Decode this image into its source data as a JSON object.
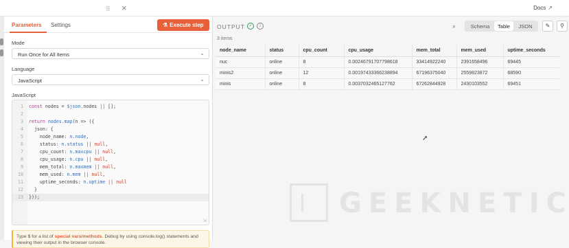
{
  "topbar": {
    "docs_label": "Docs",
    "docs_icon": "external-link-icon"
  },
  "params": {
    "tabs": [
      {
        "label": "Parameters"
      },
      {
        "label": "Settings"
      }
    ],
    "execute_label": "Execute step",
    "mode": {
      "label": "Mode",
      "value": "Run Once for All Items"
    },
    "language": {
      "label": "Language",
      "value": "JavaScript"
    },
    "code_label": "JavaScript",
    "code_lines": [
      "const nodes = $json.nodes || [];",
      "",
      "return nodes.map(n => ({",
      "  json: {",
      "    node_name: n.node,",
      "    status: n.status || null,",
      "    cpu_count: n.maxcpu || null,",
      "    cpu_usage: n.cpu || null,",
      "    mem_total: n.maxmem || null,",
      "    mem_used: n.mem || null,",
      "    uptime_seconds: n.uptime || null",
      "  }",
      "}));"
    ],
    "hint": {
      "pre": "Type $ for a list of ",
      "link": "special vars/methods",
      "post": ". Debug by using console.log() statements and viewing their output in the browser console."
    }
  },
  "output": {
    "title": "OUTPUT",
    "items_count": "3 items",
    "views": [
      {
        "label": "Schema"
      },
      {
        "label": "Table"
      },
      {
        "label": "JSON"
      }
    ],
    "active_view": "Table",
    "columns": [
      "node_name",
      "status",
      "cpu_count",
      "cpu_usage",
      "mem_total",
      "mem_used",
      "uptime_seconds"
    ],
    "rows": [
      [
        "nuc",
        "online",
        "8",
        "0.00246791707798618",
        "33414922240",
        "2391658496",
        "69445"
      ],
      [
        "minis2",
        "online",
        "12",
        "0.00197433366238894",
        "67196375040",
        "2559823872",
        "68590"
      ],
      [
        "minis",
        "online",
        "8",
        "0.0037032465127762",
        "67262844928",
        "2430103552",
        "69451"
      ]
    ]
  },
  "watermark": {
    "text": "GEEKNETIC"
  }
}
